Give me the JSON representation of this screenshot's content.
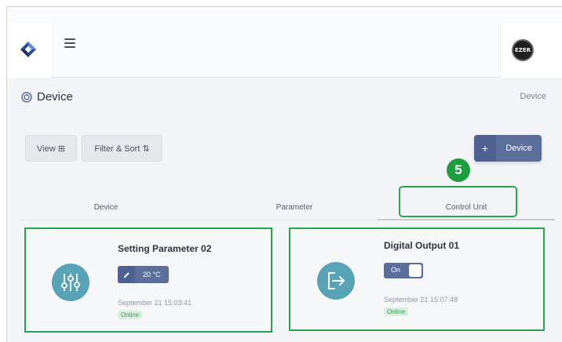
{
  "header": {
    "logo": "diamond-logo-icon",
    "menu": "hamburger-menu-icon",
    "avatar_text": "EZER"
  },
  "page": {
    "title": "Device",
    "title_icon": "chip-icon",
    "breadcrumb": "Device"
  },
  "toolbar": {
    "view_label": "View ⊞",
    "filter_label": "Filter & Sort ⇅",
    "add_plus": "+",
    "add_label": "Device"
  },
  "step_badge": "5",
  "tabs": [
    {
      "label": "Device",
      "active": false
    },
    {
      "label": "Parameter",
      "active": false
    },
    {
      "label": "Control Unit",
      "active": true
    }
  ],
  "cards": [
    {
      "title": "Setting Parameter 02",
      "icon": "sliders-icon",
      "value": "20 °C",
      "timestamp": "September 21 15:03:41",
      "status": "Online"
    },
    {
      "title": "Digital Output 01",
      "icon": "output-arrow-icon",
      "toggle_label": "On",
      "toggle_on": true,
      "timestamp": "September 21 15:07:48",
      "status": "Online"
    }
  ],
  "colors": {
    "accent": "#5c6f9a",
    "highlight": "#2aa44a",
    "icon_bg": "#58a3b5",
    "status_text": "#3d9a56"
  }
}
